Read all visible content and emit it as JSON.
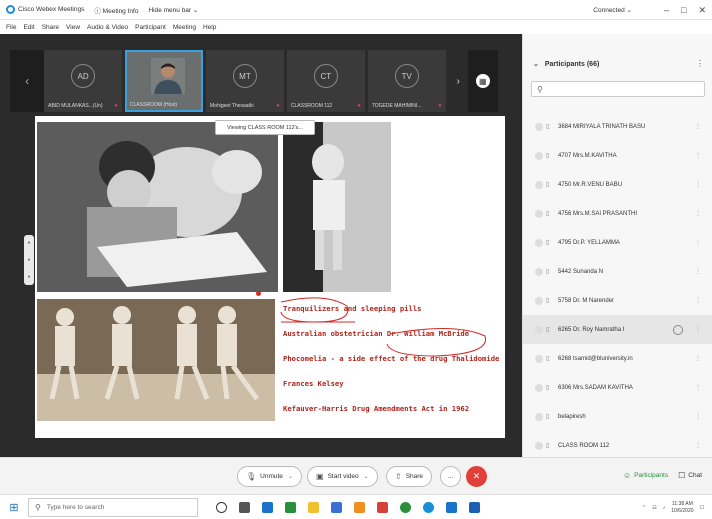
{
  "titlebar": {
    "app": "Cisco Webex Meetings",
    "meeting_info": "Meeting Info",
    "hide_menu": "Hide menu bar",
    "connected": "Connected"
  },
  "menu": [
    "File",
    "Edit",
    "Share",
    "View",
    "Audio & Video",
    "Participant",
    "Meeting",
    "Help"
  ],
  "strip": {
    "tiles": [
      {
        "initials": "AD",
        "name": "ABID MULANKAS...(Un)"
      },
      {
        "initials": "",
        "name": "CLASSROOM (Host)"
      },
      {
        "initials": "MT",
        "name": "Mohigeet Thesaatki"
      },
      {
        "initials": "CT",
        "name": "CLASSROOM 112"
      },
      {
        "initials": "TV",
        "name": "TOGEDE MAHIMINI..."
      }
    ]
  },
  "tooltip": "Viewing CLASS ROOM 112's...",
  "slide": {
    "lines": [
      "Tranquilizers and sleeping pills",
      "Australian obstetrician Dr. William McBride",
      "Phocomelia - a side effect of the drug Thalidomide",
      "Frances Kelsey",
      "Kefauver-Harris Drug Amendments Act in 1962"
    ]
  },
  "controls": {
    "unmute": "Unmute",
    "start_video": "Start video",
    "share": "Share",
    "more": "...",
    "leave": "✕"
  },
  "panel": {
    "title": "Participants (66)",
    "search_icon": "search-icon",
    "participants": [
      {
        "name": "3684 MIRIYALA TRINATH BASU",
        "selected": false
      },
      {
        "name": "4707 Mrs.M.KAVITHA",
        "selected": false
      },
      {
        "name": "4750 Mr.R.VENU BABU",
        "selected": false
      },
      {
        "name": "4756 Mrs.M.SAI PRASANTHI",
        "selected": false
      },
      {
        "name": "4795 Dr.P. YELLAMMA",
        "selected": false
      },
      {
        "name": "5442 Sunanda N",
        "selected": false
      },
      {
        "name": "5758 Dr. M Narender",
        "selected": false
      },
      {
        "name": "6265 Dr. Roy Namratha I",
        "selected": true
      },
      {
        "name": "6268 tsamid@bluniversity.in",
        "selected": false
      },
      {
        "name": "6306 Mrs.SADAM KAVITHA",
        "selected": false
      },
      {
        "name": "belapiresh",
        "selected": false
      },
      {
        "name": "CLASS ROOM 112",
        "selected": false
      }
    ],
    "participants_btn": "Participants",
    "chat_btn": "Chat"
  },
  "taskbar": {
    "search_placeholder": "Type here to search",
    "time": "11:38 AM",
    "date": "10/6/2020"
  },
  "colors": {
    "accent": "#1a8fd6",
    "leave": "#e0403a",
    "slide_text": "#b0241b"
  }
}
